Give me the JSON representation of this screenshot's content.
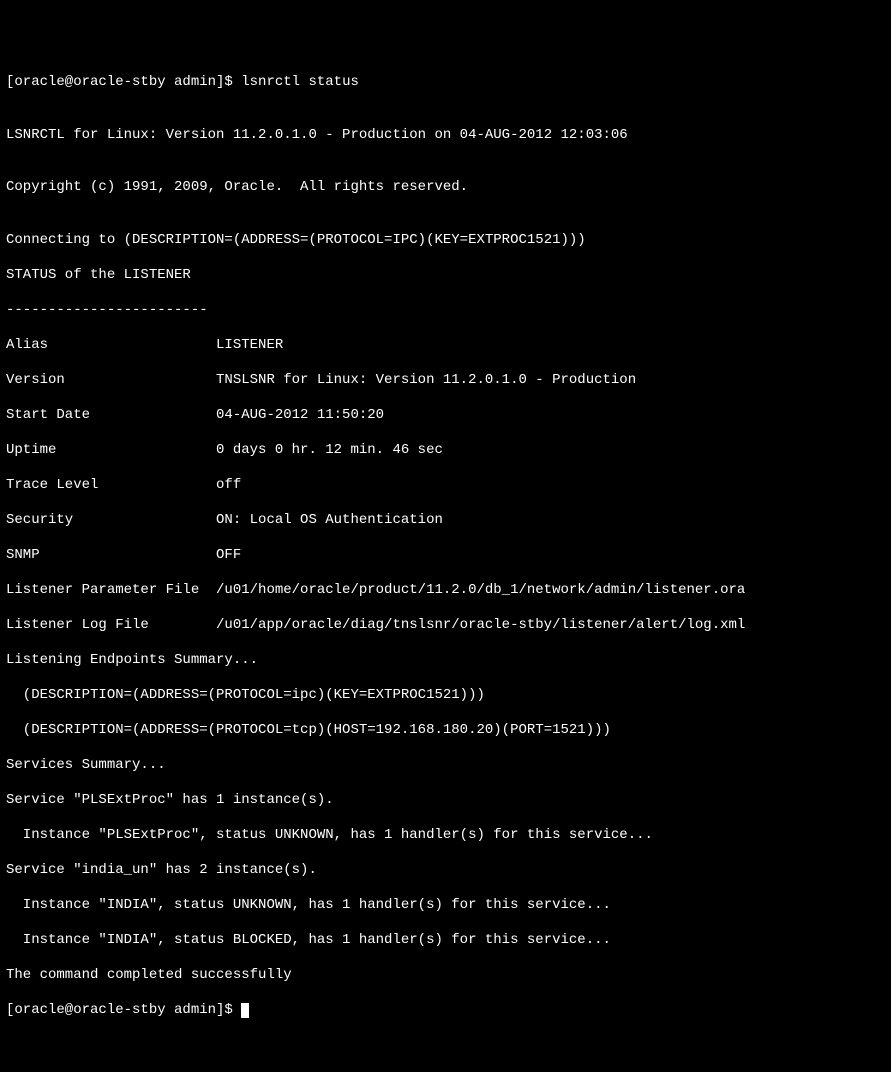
{
  "prompt1": "[oracle@oracle-stby admin]$ ",
  "command": "lsnrctl status",
  "blank": "",
  "header_line": "LSNRCTL for Linux: Version 11.2.0.1.0 - Production on 04-AUG-2012 12:03:06",
  "copyright": "Copyright (c) 1991, 2009, Oracle.  All rights reserved.",
  "connecting": "Connecting to (DESCRIPTION=(ADDRESS=(PROTOCOL=IPC)(KEY=EXTPROC1521)))",
  "status_header": "STATUS of the LISTENER",
  "dashes": "------------------------",
  "kv": {
    "alias_label": "Alias",
    "alias_value": "LISTENER",
    "version_label": "Version",
    "version_value": "TNSLSNR for Linux: Version 11.2.0.1.0 - Production",
    "start_label": "Start Date",
    "start_value": "04-AUG-2012 11:50:20",
    "uptime_label": "Uptime",
    "uptime_value": "0 days 0 hr. 12 min. 46 sec",
    "trace_label": "Trace Level",
    "trace_value": "off",
    "security_label": "Security",
    "security_value": "ON: Local OS Authentication",
    "snmp_label": "SNMP",
    "snmp_value": "OFF",
    "param_label": "Listener Parameter File",
    "param_value": "/u01/home/oracle/product/11.2.0/db_1/network/admin/listener.ora",
    "log_label": "Listener Log File",
    "log_value": "/u01/app/oracle/diag/tnslsnr/oracle-stby/listener/alert/log.xml"
  },
  "endpoints_header": "Listening Endpoints Summary...",
  "endpoint1": "  (DESCRIPTION=(ADDRESS=(PROTOCOL=ipc)(KEY=EXTPROC1521)))",
  "endpoint2": "  (DESCRIPTION=(ADDRESS=(PROTOCOL=tcp)(HOST=192.168.180.20)(PORT=1521)))",
  "services_header": "Services Summary...",
  "svc1": "Service \"PLSExtProc\" has 1 instance(s).",
  "svc1_inst": "  Instance \"PLSExtProc\", status UNKNOWN, has 1 handler(s) for this service...",
  "svc2": "Service \"india_un\" has 2 instance(s).",
  "svc2_inst1": "  Instance \"INDIA\", status UNKNOWN, has 1 handler(s) for this service...",
  "svc2_inst2": "  Instance \"INDIA\", status BLOCKED, has 1 handler(s) for this service...",
  "completed": "The command completed successfully",
  "prompt2": "[oracle@oracle-stby admin]$ "
}
